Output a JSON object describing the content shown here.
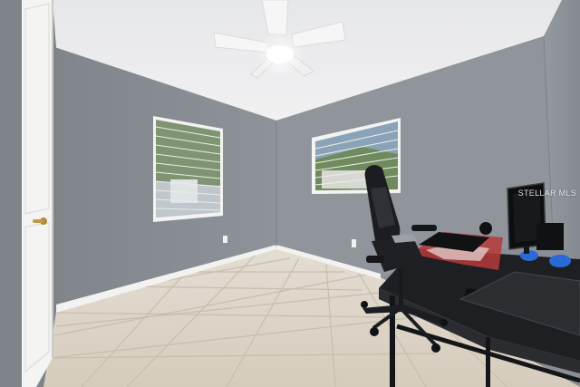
{
  "scene": {
    "watermark": "STELLAR MLS",
    "colors": {
      "ceiling": "#e9eaec",
      "wall_left": "#878c93",
      "wall_back": "#8e949a",
      "wall_right": "#8d9298",
      "floor": "#dcd3c6",
      "grout": "#c9bfb0",
      "baseboard": "#f2f2f0",
      "door": "#f4f4f2",
      "desk": "#1d1f22",
      "window_blind": "#f3f4f2"
    },
    "icons": [
      "ceiling-fan-icon",
      "office-chair-icon",
      "monitor-icon",
      "keyboard-icon",
      "mouse-icon",
      "door-handle-icon"
    ]
  }
}
